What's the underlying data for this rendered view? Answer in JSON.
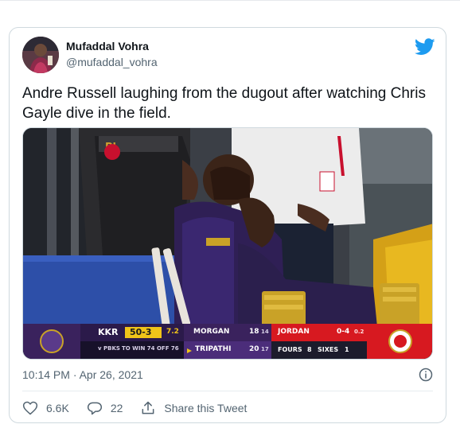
{
  "tweet": {
    "author_name": "Mufaddal Vohra",
    "author_handle": "@mufaddal_vohra",
    "text": "Andre Russell laughing from the dugout after watching Chris Gayle dive in the field.",
    "timestamp": "10:14 PM · Apr 26, 2021",
    "likes": "6.6K",
    "replies": "22",
    "share_label": "Share this Tweet"
  },
  "scoreboard": {
    "team": "KKR",
    "score": "50-3",
    "overs": "7.2",
    "vs_line": "v PBKS",
    "target_line": "TO WIN 74 OFF 76",
    "batter1_name": "MORGAN",
    "batter1_runs": "18",
    "batter1_balls": "14",
    "batter2_name": "TRIPATHI",
    "batter2_runs": "20",
    "batter2_balls": "17",
    "bowler_name": "JORDAN",
    "bowler_figures": "0-4",
    "bowler_overs": "0.2",
    "fours_label": "FOURS",
    "fours": "8",
    "sixes_label": "SIXES",
    "sixes": "1"
  },
  "colors": {
    "twitter_blue": "#1d9bf0",
    "kkr_purple": "#3a225d",
    "score_yellow": "#f0c419",
    "pbks_red": "#d71920"
  },
  "icons": {
    "brand": "twitter-bird-icon",
    "info": "info-icon",
    "like": "heart-icon",
    "reply": "reply-icon",
    "share": "share-icon"
  }
}
